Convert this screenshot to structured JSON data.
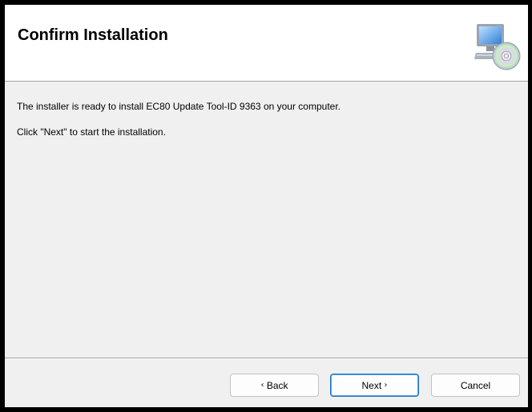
{
  "header": {
    "title": "Confirm Installation",
    "icon": "computer-cd-icon"
  },
  "body": {
    "line1": "The installer is ready to install EC80 Update Tool-ID 9363 on your computer.",
    "line2": "Click \"Next\" to start the installation."
  },
  "buttons": {
    "back": {
      "label": "Back",
      "chevron": "‹"
    },
    "next": {
      "label": "Next",
      "chevron": "›"
    },
    "cancel": {
      "label": "Cancel"
    }
  },
  "colors": {
    "window_bg": "#f0f0f0",
    "header_bg": "#ffffff",
    "default_button_border": "#1a73c8"
  }
}
